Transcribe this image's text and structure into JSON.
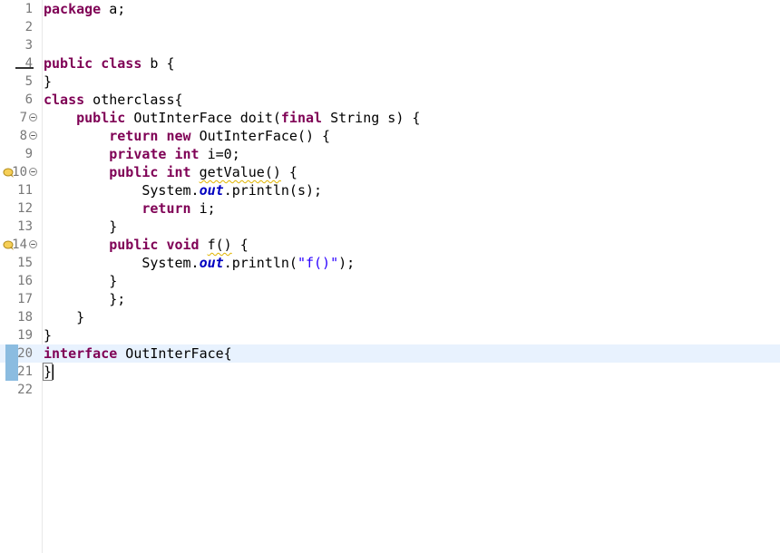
{
  "editor": {
    "language": "java",
    "current_line": 20,
    "lines": [
      {
        "n": "1",
        "tokens": [
          {
            "t": "package",
            "c": "kw"
          },
          {
            "t": " a;",
            "c": ""
          }
        ]
      },
      {
        "n": "2",
        "tokens": []
      },
      {
        "n": "3",
        "tokens": []
      },
      {
        "n": "4",
        "tokens": [
          {
            "t": "public",
            "c": "kw"
          },
          {
            "t": " ",
            "c": ""
          },
          {
            "t": "class",
            "c": "kw"
          },
          {
            "t": " b {",
            "c": ""
          }
        ]
      },
      {
        "n": "5",
        "tokens": [
          {
            "t": "}",
            "c": ""
          }
        ]
      },
      {
        "n": "6",
        "tokens": [
          {
            "t": "class",
            "c": "kw"
          },
          {
            "t": " otherclass{",
            "c": ""
          }
        ]
      },
      {
        "n": "7",
        "fold": true,
        "tokens": [
          {
            "t": "    ",
            "c": ""
          },
          {
            "t": "public",
            "c": "kw"
          },
          {
            "t": " OutInterFace doit(",
            "c": ""
          },
          {
            "t": "final",
            "c": "kw"
          },
          {
            "t": " String s) {",
            "c": ""
          }
        ]
      },
      {
        "n": "8",
        "fold": true,
        "tokens": [
          {
            "t": "        ",
            "c": ""
          },
          {
            "t": "return",
            "c": "kw"
          },
          {
            "t": " ",
            "c": ""
          },
          {
            "t": "new",
            "c": "kw"
          },
          {
            "t": " OutInterFace() {",
            "c": ""
          }
        ]
      },
      {
        "n": "9",
        "tokens": [
          {
            "t": "        ",
            "c": ""
          },
          {
            "t": "private",
            "c": "kw"
          },
          {
            "t": " ",
            "c": ""
          },
          {
            "t": "int",
            "c": "kw"
          },
          {
            "t": " i=0;",
            "c": ""
          }
        ]
      },
      {
        "n": "10",
        "fold": true,
        "warning": true,
        "tokens": [
          {
            "t": "        ",
            "c": ""
          },
          {
            "t": "public",
            "c": "kw"
          },
          {
            "t": " ",
            "c": ""
          },
          {
            "t": "int",
            "c": "kw"
          },
          {
            "t": " ",
            "c": ""
          },
          {
            "t": "getValue()",
            "c": "squig"
          },
          {
            "t": " {",
            "c": ""
          }
        ]
      },
      {
        "n": "11",
        "tokens": [
          {
            "t": "            System.",
            "c": ""
          },
          {
            "t": "out",
            "c": "fld"
          },
          {
            "t": ".println(s);",
            "c": ""
          }
        ]
      },
      {
        "n": "12",
        "tokens": [
          {
            "t": "            ",
            "c": ""
          },
          {
            "t": "return",
            "c": "kw"
          },
          {
            "t": " i;",
            "c": ""
          }
        ]
      },
      {
        "n": "13",
        "tokens": [
          {
            "t": "        }",
            "c": ""
          }
        ]
      },
      {
        "n": "14",
        "fold": true,
        "warning": true,
        "tokens": [
          {
            "t": "        ",
            "c": ""
          },
          {
            "t": "public",
            "c": "kw"
          },
          {
            "t": " ",
            "c": ""
          },
          {
            "t": "void",
            "c": "kw"
          },
          {
            "t": " ",
            "c": ""
          },
          {
            "t": "f()",
            "c": "squig"
          },
          {
            "t": " {",
            "c": ""
          }
        ]
      },
      {
        "n": "15",
        "tokens": [
          {
            "t": "            System.",
            "c": ""
          },
          {
            "t": "out",
            "c": "fld"
          },
          {
            "t": ".println(",
            "c": ""
          },
          {
            "t": "\"f()\"",
            "c": "str"
          },
          {
            "t": ");",
            "c": ""
          }
        ]
      },
      {
        "n": "16",
        "tokens": [
          {
            "t": "        }",
            "c": ""
          }
        ]
      },
      {
        "n": "17",
        "tokens": [
          {
            "t": "        };",
            "c": ""
          }
        ]
      },
      {
        "n": "18",
        "tokens": [
          {
            "t": "    }",
            "c": ""
          }
        ]
      },
      {
        "n": "19",
        "tokens": [
          {
            "t": "}",
            "c": ""
          }
        ]
      },
      {
        "n": "20",
        "change": true,
        "tokens": [
          {
            "t": "interface",
            "c": "kw"
          },
          {
            "t": " OutInterFace{",
            "c": ""
          }
        ]
      },
      {
        "n": "21",
        "change": true,
        "caret": true,
        "tokens": [
          {
            "t": "}",
            "c": "brace-box"
          }
        ]
      },
      {
        "n": "22",
        "tokens": []
      }
    ]
  },
  "colors": {
    "keyword": "#7f0055",
    "field": "#0000c0",
    "string": "#2a00ff",
    "line_number": "#787878",
    "current_line_bg": "#e8f2fe",
    "change_marker": "#8bbce0"
  },
  "icons": {
    "fold": "fold-collapse-icon",
    "warning": "override-warning-icon"
  }
}
